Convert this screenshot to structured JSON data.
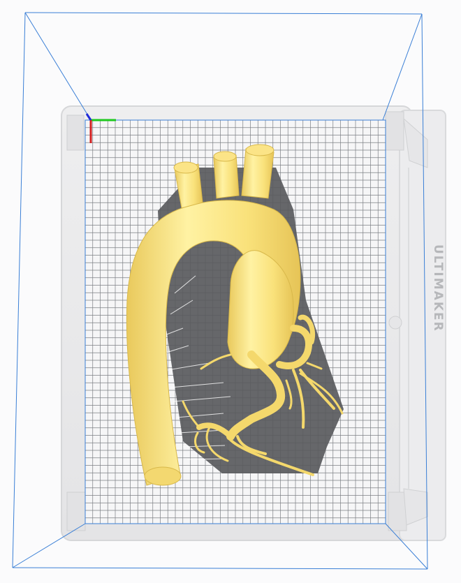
{
  "viewport": {
    "background": "#fbfbfc",
    "volume_box_color": "#3a7fd6",
    "grid_line_color": "#7c7f84",
    "plate_fill": "#f4f4f5",
    "model_fill": "#fde98a",
    "model_shade": "#e6c657",
    "shadow_color": "#58595c"
  },
  "axes": {
    "x_color": "#1ec81e",
    "y_color": "#d42020",
    "z_color": "#1f2bd8"
  },
  "printer": {
    "brand_text": "ULTIMAKER"
  },
  "icons": {
    "axis_gizmo": "axis-gizmo-icon"
  }
}
